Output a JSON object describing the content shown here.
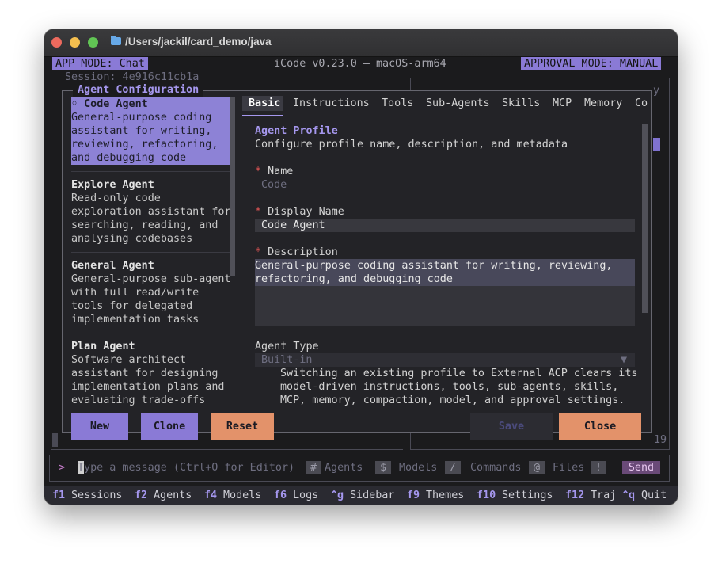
{
  "window": {
    "title": "/Users/jackil/card_demo/java",
    "colors": {
      "close": "#ed6a5e",
      "minimize": "#f5bf4f",
      "maximize": "#61c554",
      "accent": "#8a7ad6",
      "save_bg": "#ff8c00"
    }
  },
  "header": {
    "app_mode": "APP MODE: Chat",
    "version": "iCode v0.23.0 — macOS-arm64",
    "approval_mode": "APPROVAL MODE: MANUAL",
    "session": "Session: 4e916c11cb1a",
    "right_glyph": "y",
    "counter": "19"
  },
  "modal": {
    "title": "Agent Configuration",
    "agents": [
      {
        "name": "◦ Code Agent",
        "desc": [
          "General-purpose coding",
          "assistant for writing,",
          "reviewing, refactoring,",
          "and debugging code"
        ],
        "selected": true
      },
      {
        "name": "Explore Agent",
        "desc": [
          "Read-only code",
          "exploration assistant for",
          "searching, reading, and",
          "analysing codebases"
        ],
        "selected": false
      },
      {
        "name": "General Agent",
        "desc": [
          "General-purpose sub-agent",
          "with full read/write",
          "tools for delegated",
          "implementation tasks"
        ],
        "selected": false
      },
      {
        "name": "Plan Agent",
        "desc": [
          "Software architect",
          "assistant for designing",
          "implementation plans and",
          "evaluating trade-offs"
        ],
        "selected": false
      }
    ],
    "tabs": [
      "Basic",
      "Instructions",
      "Tools",
      "Sub-Agents",
      "Skills",
      "MCP",
      "Memory",
      "Co"
    ],
    "section": {
      "title": "Agent Profile",
      "subtitle": "Configure profile name, description, and metadata"
    },
    "fields": {
      "required_mark": "*",
      "name_label": "Name",
      "name_value": "Code",
      "display_label": "Display Name",
      "display_value": "Code Agent",
      "desc_label": "Description",
      "desc_lines": [
        "General-purpose coding assistant for writing, reviewing,",
        "refactoring, and debugging code"
      ],
      "type_label": "Agent Type",
      "type_value": "Built-in",
      "type_arrow": "▼",
      "type_note": [
        "Switching an existing profile to External ACP clears its",
        "model-driven instructions, tools, sub-agents, skills,",
        "MCP, memory, compaction, model, and approval settings."
      ]
    },
    "buttons": {
      "new": "New",
      "clone": "Clone",
      "reset": "Reset",
      "save": "Save",
      "close": "Close"
    }
  },
  "input": {
    "prompt": ">",
    "placeholder": "Type a message (Ctrl+O for Editor)",
    "hints": [
      {
        "key": "#",
        "label": "Agents"
      },
      {
        "key": "$",
        "label": "Models"
      },
      {
        "key": "/",
        "label": "Commands"
      },
      {
        "key": "@",
        "label": "Files"
      },
      {
        "key": "!",
        "label": ""
      }
    ],
    "send": "Send"
  },
  "footer": [
    {
      "key": "f1",
      "label": "Sessions"
    },
    {
      "key": "f2",
      "label": "Agents"
    },
    {
      "key": "f4",
      "label": "Models"
    },
    {
      "key": "f6",
      "label": "Logs"
    },
    {
      "key": "^g",
      "label": "Sidebar"
    },
    {
      "key": "f9",
      "label": "Themes"
    },
    {
      "key": "f10",
      "label": "Settings"
    },
    {
      "key": "f12",
      "label": "Traj"
    },
    {
      "key": "^q",
      "label": "Quit"
    }
  ]
}
